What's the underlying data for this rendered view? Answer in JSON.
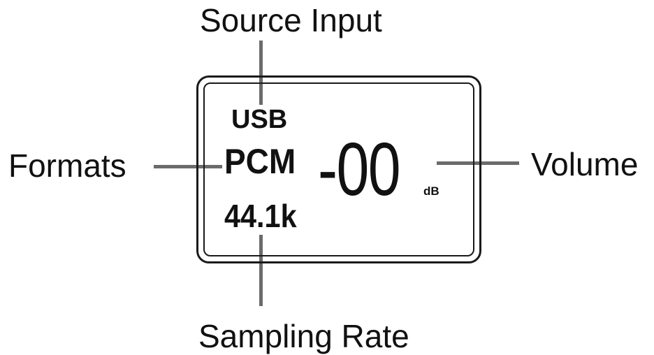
{
  "callouts": {
    "source_input": "Source Input",
    "formats": "Formats",
    "volume": "Volume",
    "sampling_rate": "Sampling Rate"
  },
  "display": {
    "source": "USB",
    "format": "PCM",
    "sample_rate": "44.1k",
    "volume_value": "-00",
    "volume_unit": "dB"
  },
  "colors": {
    "ink": "#111111",
    "leader_line": "#6b6b6b",
    "background": "#ffffff"
  }
}
